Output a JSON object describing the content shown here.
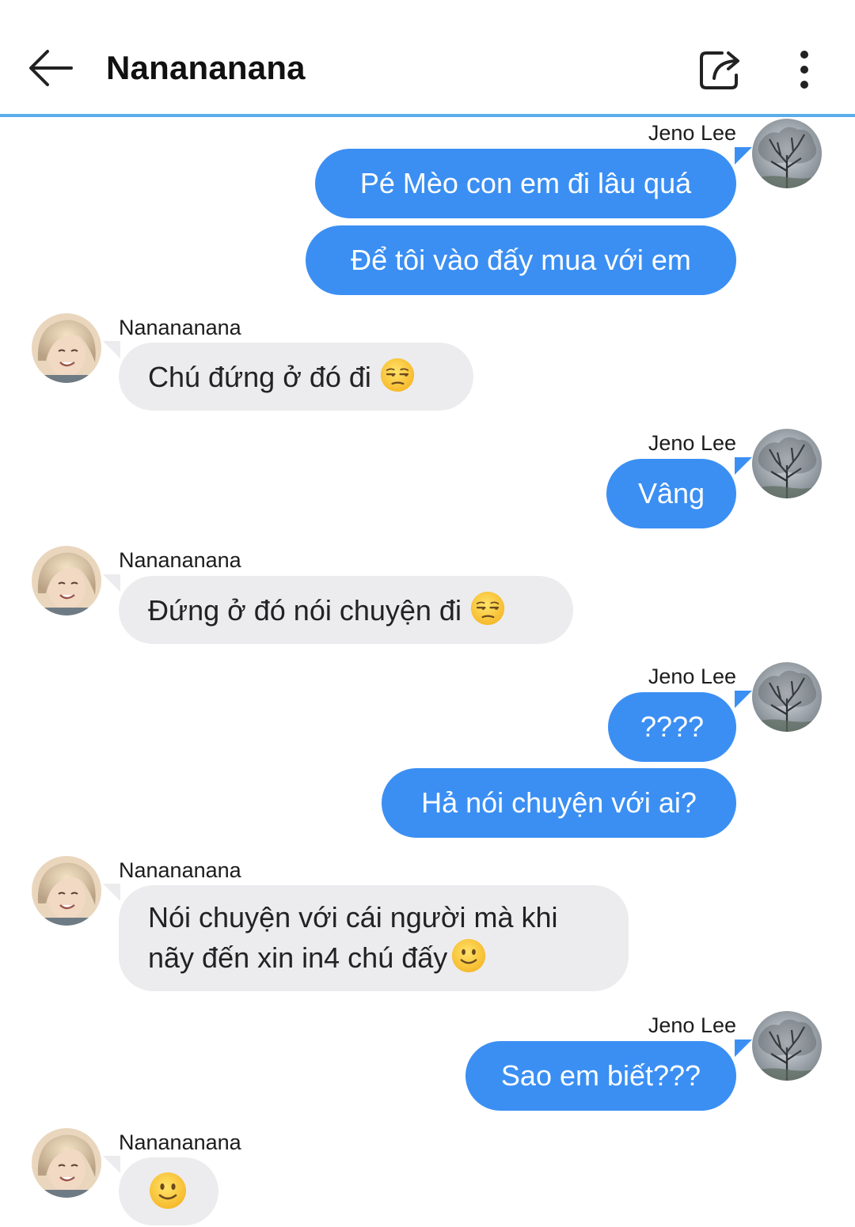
{
  "header": {
    "title": "Nanananana"
  },
  "messages": [
    {
      "sender": "Jeno Lee",
      "side": "right",
      "texts": [
        "Pé Mèo con em đi lâu quá",
        "Để tôi vào đấy mua với em"
      ]
    },
    {
      "sender": "Nanananana",
      "side": "left",
      "texts": [
        "Chú đứng ở đó đi"
      ],
      "emoji": "unamused-face"
    },
    {
      "sender": "Jeno Lee",
      "side": "right",
      "texts": [
        "Vâng"
      ]
    },
    {
      "sender": "Nanananana",
      "side": "left",
      "texts": [
        "Đứng ở đó nói chuyện đi"
      ],
      "emoji": "unamused-face"
    },
    {
      "sender": "Jeno Lee",
      "side": "right",
      "texts": [
        "????",
        "Hả nói chuyện với ai?"
      ]
    },
    {
      "sender": "Nanananana",
      "side": "left",
      "texts": [
        "Nói chuyện với cái người mà khi nãy đến xin in4 chú đấy"
      ],
      "emoji": "slightly-smiling-face"
    },
    {
      "sender": "Jeno Lee",
      "side": "right",
      "texts": [
        "Sao em biết???"
      ]
    },
    {
      "sender": "Nanananana",
      "side": "left",
      "texts": [],
      "emoji": "slightly-smiling-face"
    }
  ],
  "colors": {
    "outgoing_bubble": "#3b8ff3",
    "incoming_bubble": "#ececee",
    "header_divider": "#5aaeea"
  },
  "icons": [
    "back-arrow-icon",
    "share-icon",
    "more-vertical-icon"
  ]
}
